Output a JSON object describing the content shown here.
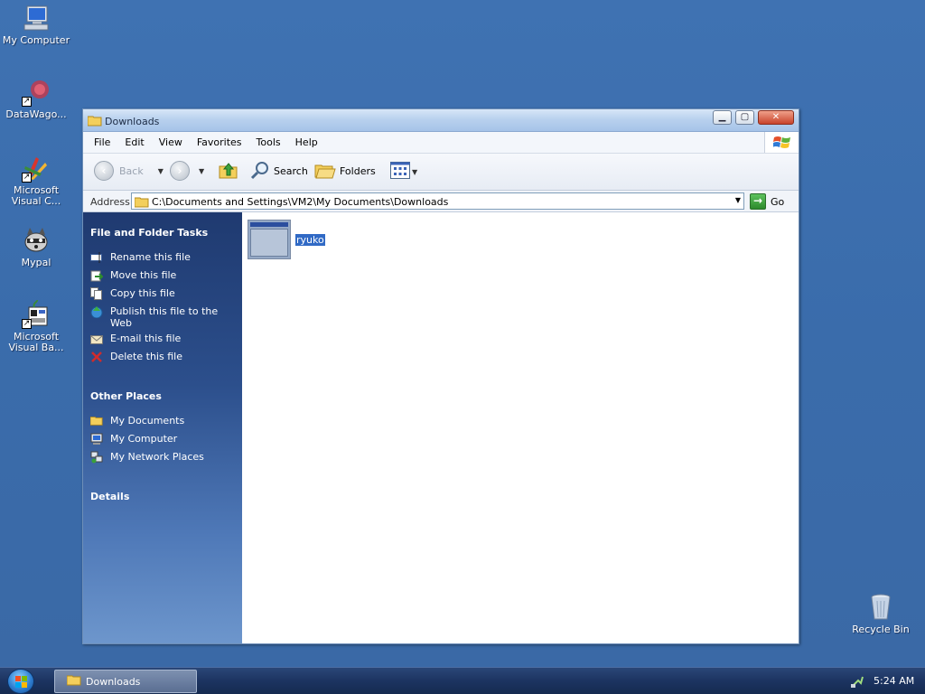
{
  "desktop": {
    "icons": [
      {
        "label": "My Computer"
      },
      {
        "label": "DataWago..."
      },
      {
        "label": "Microsoft Visual C..."
      },
      {
        "label": "Mypal"
      },
      {
        "label": "Microsoft Visual Ba..."
      },
      {
        "label": "Recycle Bin"
      }
    ]
  },
  "window": {
    "title": "Downloads",
    "menu": [
      "File",
      "Edit",
      "View",
      "Favorites",
      "Tools",
      "Help"
    ],
    "toolbar": {
      "back_label": "Back",
      "search_label": "Search",
      "folders_label": "Folders"
    },
    "address": {
      "label": "Address",
      "value": "C:\\Documents and Settings\\VM2\\My Documents\\Downloads",
      "go_label": "Go"
    },
    "taskpane": {
      "file_tasks": {
        "title": "File and Folder Tasks",
        "items": [
          {
            "label": "Rename this file",
            "icon": "rename-icon"
          },
          {
            "label": "Move this file",
            "icon": "move-icon"
          },
          {
            "label": "Copy this file",
            "icon": "copy-icon"
          },
          {
            "label": "Publish this file to the Web",
            "icon": "publish-icon"
          },
          {
            "label": "E-mail this file",
            "icon": "email-icon"
          },
          {
            "label": "Delete this file",
            "icon": "delete-icon"
          }
        ]
      },
      "other_places": {
        "title": "Other Places",
        "items": [
          {
            "label": "My Documents",
            "icon": "folder-icon"
          },
          {
            "label": "My Computer",
            "icon": "computer-icon"
          },
          {
            "label": "My Network Places",
            "icon": "network-icon"
          }
        ]
      },
      "details": {
        "title": "Details"
      }
    },
    "files": [
      {
        "name": "ryuko",
        "selected": true
      }
    ]
  },
  "taskbar": {
    "task_label": "Downloads",
    "clock": "5:24 AM"
  },
  "colors": {
    "selection": "#316ac5",
    "desktop": "#3a6ea5",
    "taskpane_top": "#1f3a70"
  }
}
